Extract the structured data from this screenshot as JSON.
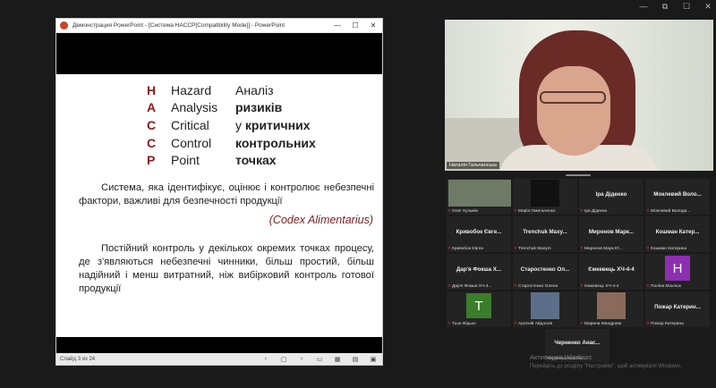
{
  "ppt": {
    "title": "Демонстрация PowerPoint - [Система HACCP[Compatibility Mode]] - PowerPoint",
    "status_slide": "Слайд 3 из 24",
    "winbtns": [
      "—",
      "☐",
      "✕"
    ]
  },
  "slide": {
    "rows": [
      {
        "letter": "H",
        "en": "Hazard",
        "ua": "Аналіз",
        "bold": false
      },
      {
        "letter": "A",
        "en": "Analysis",
        "ua": "ризиків",
        "bold": true
      },
      {
        "letter": "C",
        "en": "Critical",
        "ua_pre": "у ",
        "ua": "критичних",
        "bold": true
      },
      {
        "letter": "C",
        "en": "Control",
        "ua": "контрольних",
        "bold": true
      },
      {
        "letter": "P",
        "en": "Point",
        "ua": "точках",
        "bold": true
      }
    ],
    "para1": "Система, яка ідентифікує, оцінює і контролює небезпечні фактори, важливі для безпечності продукції",
    "codex": "(Codex Alimentarius)",
    "para2": "Постійний контроль у декількох окремих точках процесу, де з'являються небезпечні чинники, більш простий, більш надійний і менш витратний, ніж вибірковий контроль готової продукції"
  },
  "speaker": {
    "name": "Наталія Гальчинська"
  },
  "participants": [
    {
      "name": "",
      "label": "Олег Кузьмін",
      "type": "photo",
      "color": "#7a8a6a"
    },
    {
      "name": "",
      "label": "Марія Омельченко",
      "type": "blank"
    },
    {
      "name": "Іра Діденко",
      "label": "Іра Діденко",
      "type": "name"
    },
    {
      "name": "Моклевий Воло...",
      "label": "Моклевий Володи...",
      "type": "name"
    },
    {
      "name": "Кривобок Євге...",
      "label": "Кривобок Євген",
      "type": "name"
    },
    {
      "name": "Trenchuk Maxy...",
      "label": "Trenchuk Maxym",
      "type": "name"
    },
    {
      "name": "Миронов Марк...",
      "label": "Миронов Марк Ю...",
      "type": "name"
    },
    {
      "name": "Кошман Катер...",
      "label": "Кошман Катерина",
      "type": "name"
    },
    {
      "name": "Дар'я Фокша Х...",
      "label": "Дар'я Фокша ХЧ-4...",
      "type": "name"
    },
    {
      "name": "Старостенко Ол...",
      "label": "Старостенко Олена",
      "type": "name"
    },
    {
      "name": "Ємкевець ХЧ-4-4",
      "label": "Ємкевець ХЧ-4-4",
      "type": "name"
    },
    {
      "name": "",
      "label": "Поліна Моклюк",
      "type": "avatar",
      "letter": "H",
      "color": "#8b2fb0"
    },
    {
      "name": "",
      "label": "Тьон Фідько",
      "type": "avatar",
      "letter": "T",
      "color": "#3a7d2a"
    },
    {
      "name": "",
      "label": "Арсеній Айдолов",
      "type": "photo",
      "color": "#5b6f8a"
    },
    {
      "name": "",
      "label": "Марина Мандрова",
      "type": "photo",
      "color": "#8a6a5a"
    },
    {
      "name": "Пожар Катерин...",
      "label": "Пожар Катерина",
      "type": "name"
    }
  ],
  "extra_participant": {
    "name": "Черненко Анас...",
    "label": "Черненко Анастас..."
  },
  "watermark": {
    "line1": "Активация Windows",
    "line2": "Перейдіть до розділу \"Настройки\", щоб активувати Windows."
  },
  "zoom_controls": [
    "—",
    "⧉",
    "☐",
    "✕"
  ]
}
